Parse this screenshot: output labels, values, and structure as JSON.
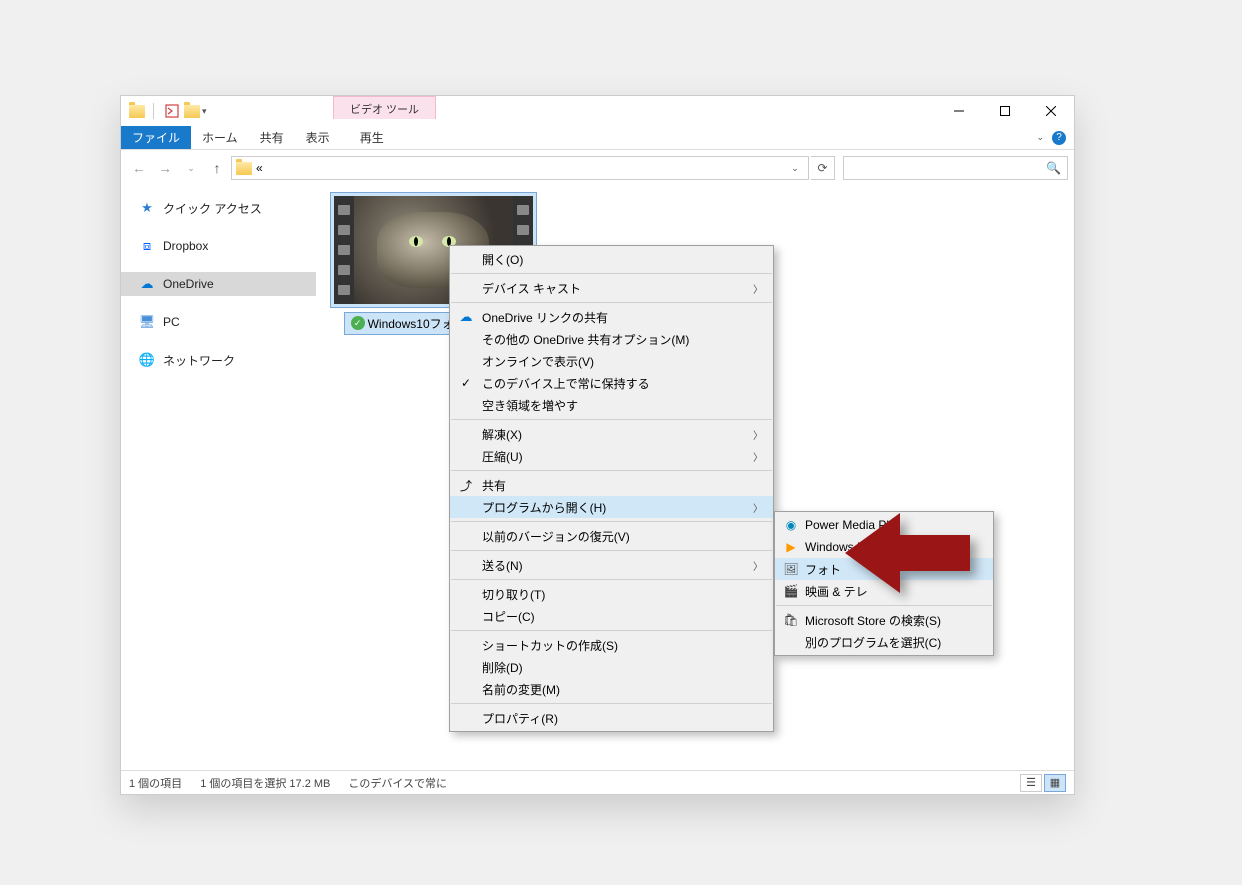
{
  "titlebar": {
    "context_tab": "ビデオ ツール"
  },
  "ribbon": {
    "file": "ファイル",
    "home": "ホーム",
    "share": "共有",
    "view": "表示",
    "playback": "再生"
  },
  "address": {
    "path_text": "«"
  },
  "search": {
    "placeholder": ""
  },
  "sidebar": {
    "quick_access": "クイック アクセス",
    "dropbox": "Dropbox",
    "onedrive": "OneDrive",
    "pc": "PC",
    "network": "ネットワーク"
  },
  "file": {
    "name": "Windows10フォルング.mov"
  },
  "status": {
    "item_count": "1 個の項目",
    "selection": "1 個の項目を選択 17.2 MB",
    "sync": "このデバイスで常に"
  },
  "context_menu": {
    "open": "開く(O)",
    "cast": "デバイス キャスト",
    "onedrive_share": "OneDrive リンクの共有",
    "onedrive_more": "その他の OneDrive 共有オプション(M)",
    "view_online": "オンラインで表示(V)",
    "always_keep": "このデバイス上で常に保持する",
    "free_space": "空き領域を増やす",
    "extract": "解凍(X)",
    "compress": "圧縮(U)",
    "share": "共有",
    "open_with": "プログラムから開く(H)",
    "restore": "以前のバージョンの復元(V)",
    "send_to": "送る(N)",
    "cut": "切り取り(T)",
    "copy": "コピー(C)",
    "shortcut": "ショートカットの作成(S)",
    "delete": "削除(D)",
    "rename": "名前の変更(M)",
    "properties": "プロパティ(R)"
  },
  "submenu": {
    "power_media": "Power Media Pl",
    "windows_media": "Windows M",
    "photos": "フォト",
    "movies_tv": "映画 & テレ",
    "store_search": "Microsoft Store の検索(S)",
    "choose_another": "別のプログラムを選択(C)"
  }
}
